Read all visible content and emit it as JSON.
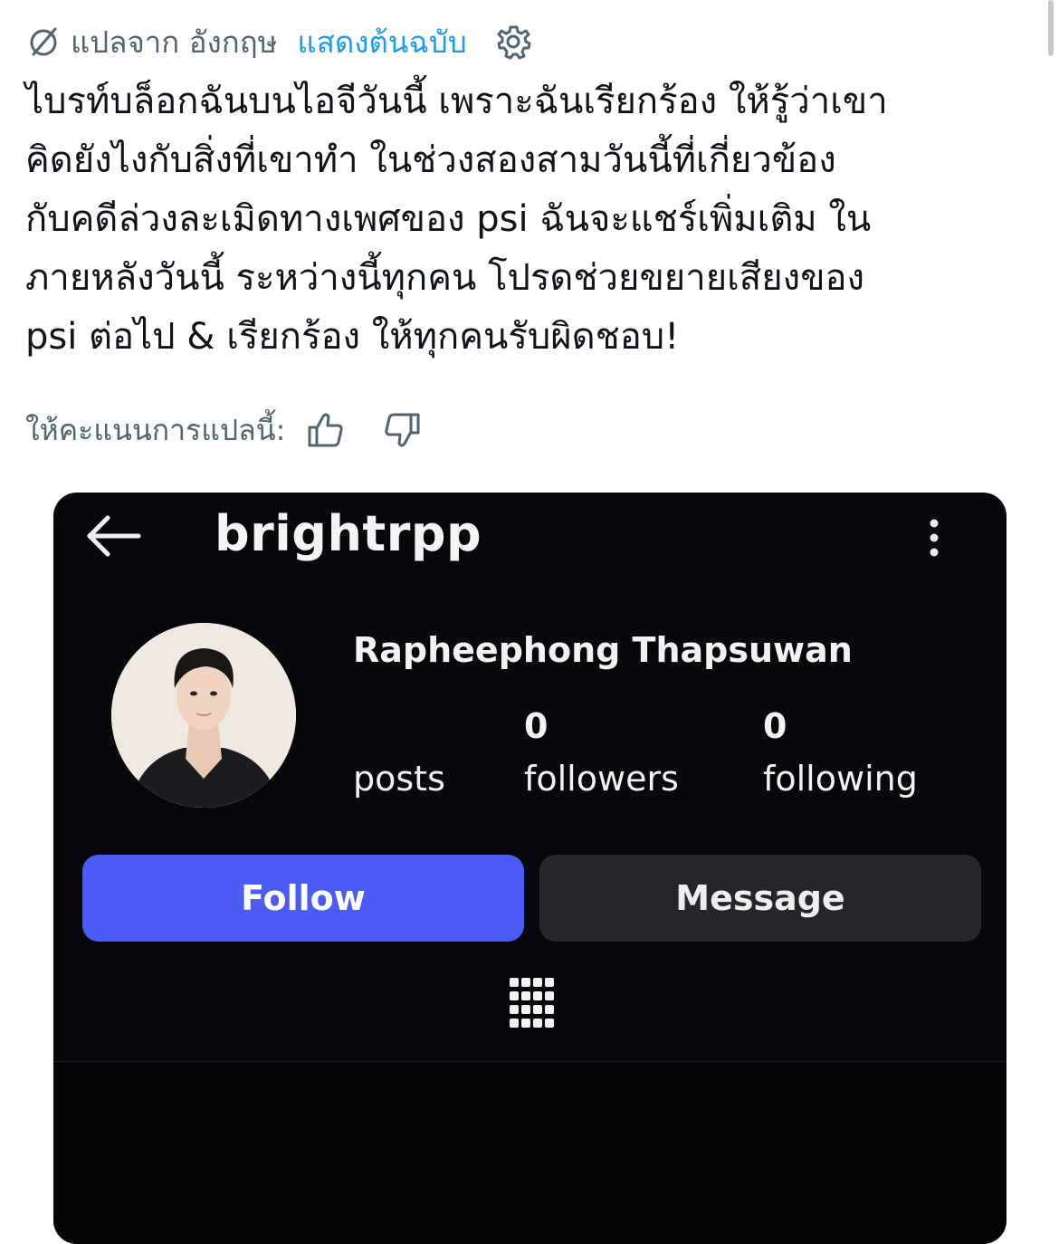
{
  "translation": {
    "icon": "globe-icon",
    "from_label": "แปลจาก อังกฤษ",
    "show_original": "แสดงต้นฉบับ",
    "settings_icon": "gear-icon"
  },
  "tweet": {
    "lines": [
      "ไบรท์บล็อกฉันบนไอจีวันนี้ เพราะฉันเรียกร้อง ให้รู้ว่าเขา",
      "คิดยังไงกับสิ่งที่เขาทำ ในช่วงสองสามวันนี้ที่เกี่ยวข้อง",
      "กับคดีล่วงละเมิดทางเพศของ psi ฉันจะแชร์เพิ่มเติม ใน",
      "ภายหลังวันนี้ ระหว่างนี้ทุกคน โปรดช่วยขยายเสียงของ",
      "psi ต่อไป & เรียกร้อง ให้ทุกคนรับผิดชอบ!"
    ]
  },
  "rating": {
    "label": "ให้คะแนนการแปลนี้:",
    "up_icon": "thumbs-up-icon",
    "down_icon": "thumbs-down-icon"
  },
  "instagram": {
    "username": "brightrpp",
    "full_name": "Rapheephong Thapsuwan",
    "stats": [
      {
        "value": "0",
        "label": "posts"
      },
      {
        "value": "0",
        "label": "followers"
      },
      {
        "value": "0",
        "label": "following"
      }
    ],
    "follow_label": "Follow",
    "message_label": "Message",
    "colors": {
      "background": "#08080c",
      "follow_button": "#4a5cf5",
      "message_button": "#25262b"
    }
  },
  "colors": {
    "link": "#1d9bf0",
    "muted_text": "#536471",
    "body_text": "#0f1419"
  }
}
